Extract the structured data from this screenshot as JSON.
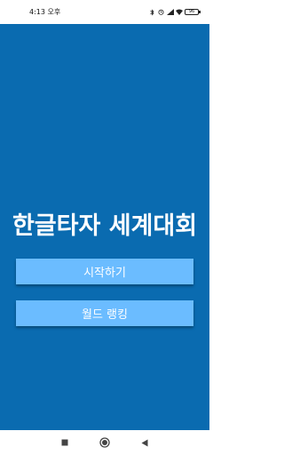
{
  "status_bar": {
    "time": "4:13 오후",
    "icons": [
      "bluetooth-icon",
      "alarm-icon",
      "signal-icon",
      "wifi-icon"
    ],
    "battery_label": "96"
  },
  "main": {
    "title": "한글타자 세계대회",
    "start_button_label": "시작하기",
    "ranking_button_label": "월드 랭킹",
    "background_color": "#0a6bb0",
    "button_color": "#6bbcff"
  },
  "nav_bar": {
    "buttons": [
      "recents-icon",
      "home-icon",
      "back-icon"
    ]
  }
}
